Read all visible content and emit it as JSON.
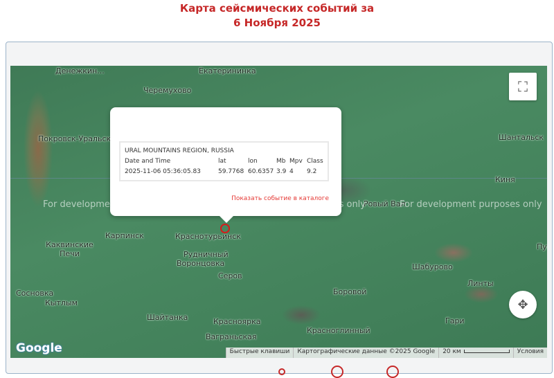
{
  "title": {
    "line1": "Карта сейсмических событий за",
    "line2": "6 Ноября 2025"
  },
  "map": {
    "places": [
      "Денежкин...",
      "Екатерининка",
      "Черемухово",
      "Покровск-Уральский",
      "Шантальск",
      "Киня",
      "Карпинск",
      "Краснотурьинск",
      "Рудничный",
      "Воронцовка",
      "Каквинские Печи",
      "Серов",
      "Шабурово",
      "Пуксин",
      "Сосновка",
      "Кытлым",
      "Боровой",
      "Линты",
      "Шайтанка",
      "Красноярка",
      "Гари",
      "Ваграньская",
      "Красноглинный",
      "Ровый Вал"
    ],
    "watermark": "For development purposes only",
    "fullscreen_icon": "fullscreen-icon",
    "pan_icon": "pan-arrows-icon",
    "marker_color": "#d81b1b"
  },
  "popup": {
    "region": "URAL MOUNTAINS REGION, RUSSIA",
    "headers": [
      "Date and Time",
      "lat",
      "lon",
      "Mb",
      "Mpv",
      "Class"
    ],
    "values": [
      "2025-11-06 05:36:05.83",
      "59.7768",
      "60.6357",
      "3.9",
      "4",
      "9.2"
    ],
    "link": "Показать событие в каталоге"
  },
  "footer": {
    "logo": "Google",
    "shortcuts": "Быстрые клавиши",
    "map_data": "Картографические данные ©2025 Google",
    "scale": "20 км",
    "terms": "Условия"
  }
}
